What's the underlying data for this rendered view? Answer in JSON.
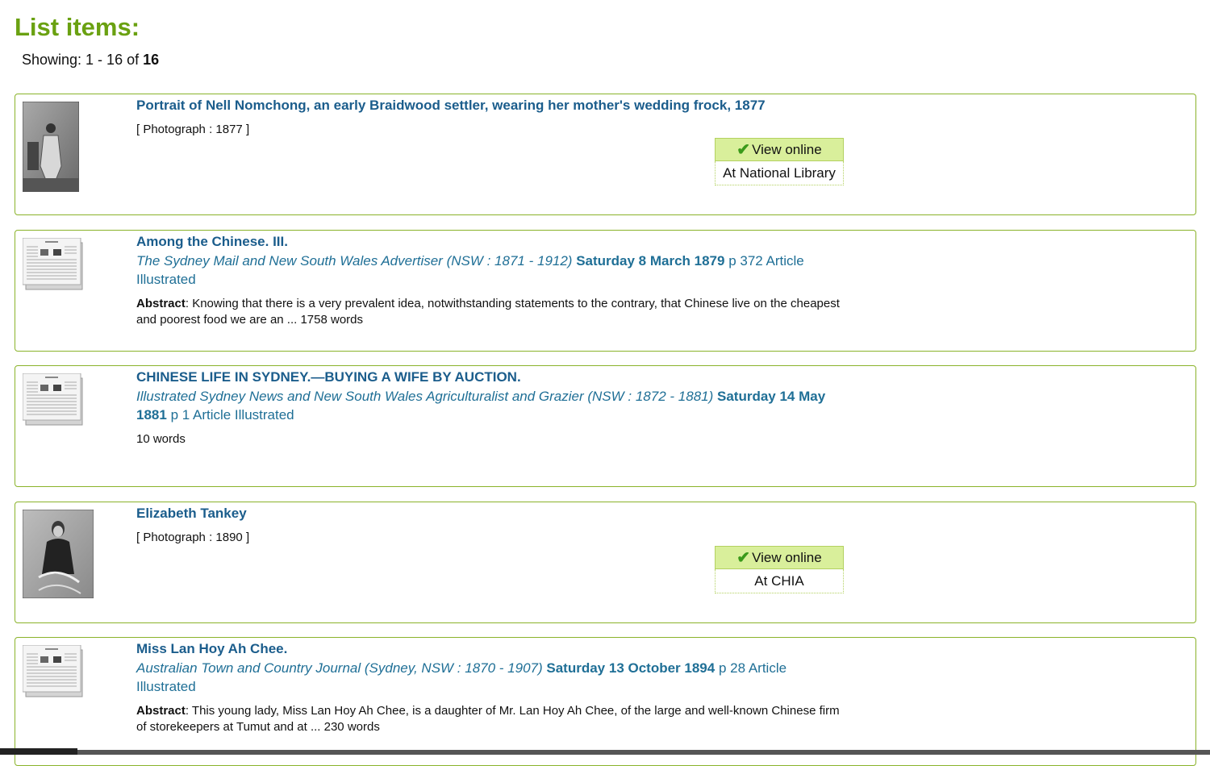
{
  "heading": "List items:",
  "showing": {
    "prefix": "Showing: 1 - 16 of ",
    "total": "16"
  },
  "items": [
    {
      "title": "Portrait of Nell Nomchong, an early Braidwood settler, wearing her mother's wedding frock, 1877",
      "meta": "[ Photograph : 1877 ]",
      "view_label": "View online",
      "view_at": "At National Library"
    },
    {
      "title": "Among the Chinese. III.",
      "source_italic": "The Sydney Mail and New South Wales Advertiser (NSW : 1871 - 1912)",
      "source_date": "Saturday 8 March 1879",
      "source_rest": "p 372 Article Illustrated",
      "abstract_label": "Abstract",
      "abstract_text": ": Knowing that there is a very prevalent idea, notwithstanding statements to the contrary, that Chinese live on the cheapest and poorest food we are an ... 1758 words"
    },
    {
      "title": "CHINESE LIFE IN SYDNEY.—BUYING A WIFE BY AUCTION.",
      "source_italic": "Illustrated Sydney News and New South Wales Agriculturalist and Grazier (NSW : 1872 - 1881)",
      "source_date": "Saturday 14 May 1881",
      "source_rest": "p 1 Article Illustrated",
      "words": "10 words"
    },
    {
      "title": "Elizabeth Tankey",
      "meta": "[ Photograph : 1890 ]",
      "view_label": "View online",
      "view_at": "At CHIA"
    },
    {
      "title": "Miss Lan Hoy Ah Chee.",
      "source_italic": "Australian Town and Country Journal (Sydney, NSW : 1870 - 1907)",
      "source_date": "Saturday 13 October 1894",
      "source_rest": "p 28 Article Illustrated",
      "abstract_label": "Abstract",
      "abstract_text": ": This young lady, Miss Lan Hoy Ah Chee, is a daughter of Mr. Lan Hoy Ah Chee, of the large and well-known Chinese firm of storekeepers at Tumut and at ... 230 words"
    }
  ],
  "colors": {
    "heading": "#6aa111",
    "link": "#1b5d8c",
    "border": "#8ab32a",
    "button": "#d9ef9b"
  },
  "icons": [
    "photo-thumbnail",
    "newspaper-icon",
    "checkmark-icon"
  ]
}
